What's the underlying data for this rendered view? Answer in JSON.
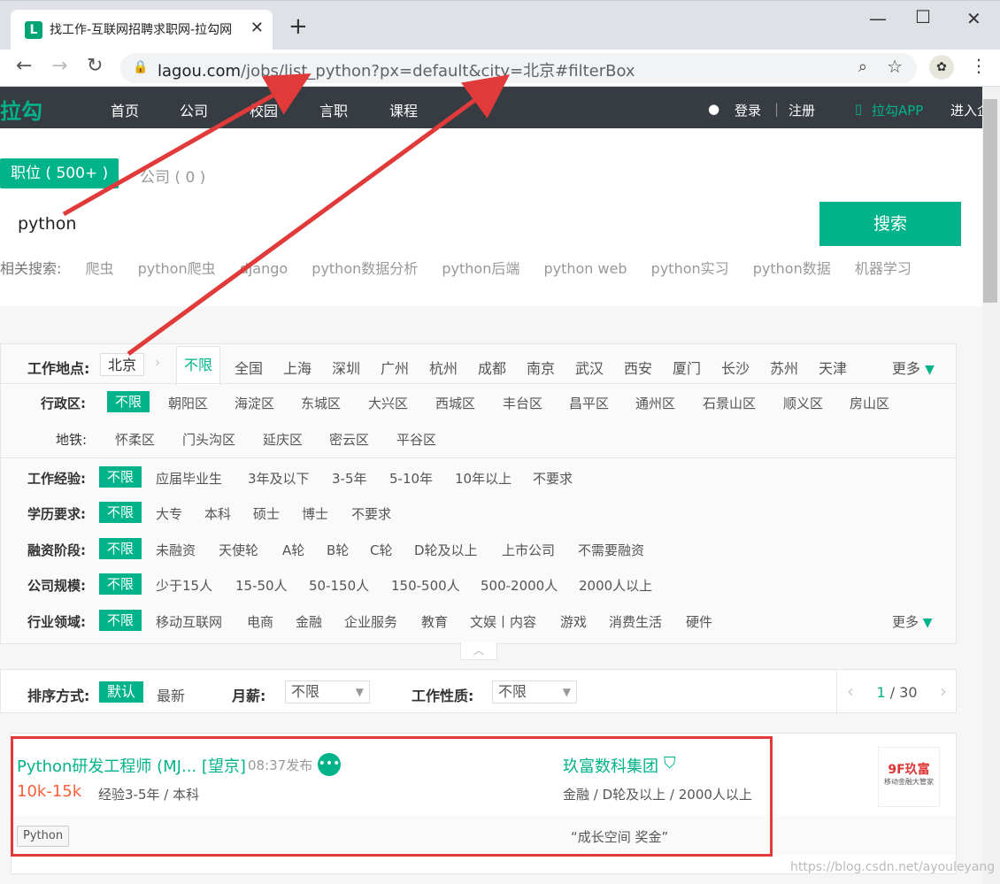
{
  "browser": {
    "tab_title": "找工作-互联网招聘求职网-拉勾网",
    "tab_favicon": "L",
    "tab_close": "✕",
    "new_tab": "+",
    "url_host": "lagou.com",
    "url_path": "/jobs/list_python?px=default&city=北京#filterBox"
  },
  "site": {
    "logo": "拉勾",
    "nav": [
      "首页",
      "公司",
      "校园",
      "言职",
      "课程"
    ],
    "login": "登录",
    "register": "注册",
    "app": "拉勾APP",
    "enter": "进入企"
  },
  "search": {
    "tab_jobs": "职位 ( 500+ )",
    "tab_companies": "公司 ( 0 )",
    "query": "python",
    "button": "搜索",
    "related_label": "相关搜索:",
    "related": [
      "爬虫",
      "python爬虫",
      "django",
      "python数据分析",
      "python后端",
      "python web",
      "python实习",
      "python数据",
      "机器学习"
    ]
  },
  "filters": {
    "location_label": "工作地点:",
    "current_city": "北京",
    "cities": [
      "不限",
      "全国",
      "上海",
      "深圳",
      "广州",
      "杭州",
      "成都",
      "南京",
      "武汉",
      "西安",
      "厦门",
      "长沙",
      "苏州",
      "天津"
    ],
    "more": "更多",
    "district_label": "行政区:",
    "districts": [
      "不限",
      "朝阳区",
      "海淀区",
      "东城区",
      "大兴区",
      "西城区",
      "丰台区",
      "昌平区",
      "通州区",
      "石景山区",
      "顺义区",
      "房山区"
    ],
    "subway_label": "地铁:",
    "districts2": [
      "怀柔区",
      "门头沟区",
      "延庆区",
      "密云区",
      "平谷区"
    ],
    "experience_label": "工作经验:",
    "experience": [
      "不限",
      "应届毕业生",
      "3年及以下",
      "3-5年",
      "5-10年",
      "10年以上",
      "不要求"
    ],
    "education_label": "学历要求:",
    "education": [
      "不限",
      "大专",
      "本科",
      "硕士",
      "博士",
      "不要求"
    ],
    "funding_label": "融资阶段:",
    "funding": [
      "不限",
      "未融资",
      "天使轮",
      "A轮",
      "B轮",
      "C轮",
      "D轮及以上",
      "上市公司",
      "不需要融资"
    ],
    "size_label": "公司规模:",
    "size": [
      "不限",
      "少于15人",
      "15-50人",
      "50-150人",
      "150-500人",
      "500-2000人",
      "2000人以上"
    ],
    "industry_label": "行业领域:",
    "industry": [
      "不限",
      "移动互联网",
      "电商",
      "金融",
      "企业服务",
      "教育",
      "文娱丨内容",
      "游戏",
      "消费生活",
      "硬件"
    ]
  },
  "sort": {
    "label": "排序方式:",
    "default": "默认",
    "latest": "最新",
    "salary_label": "月薪:",
    "salary_value": "不限",
    "nature_label": "工作性质:",
    "nature_value": "不限",
    "page_current": "1",
    "page_total": "/ 30"
  },
  "job": {
    "title": "Python研发工程师 (MJ... [望京]",
    "published": "08:37发布",
    "salary": "10k-15k",
    "requirements": "经验3-5年 / 本科",
    "company": "玖富数科集团",
    "company_info": "金融 / D轮及以上 / 2000人以上",
    "tag": "Python",
    "welfare": "“成长空间 奖金”",
    "logo_text": "9F玖富",
    "logo_sub": "移动金融大管家"
  },
  "watermark": "https://blog.csdn.net/ayouleyang",
  "colors": {
    "accent": "#00b38a",
    "salary": "#fd5f39",
    "annotation": "#e03a3a",
    "header_bg": "#363c42"
  }
}
